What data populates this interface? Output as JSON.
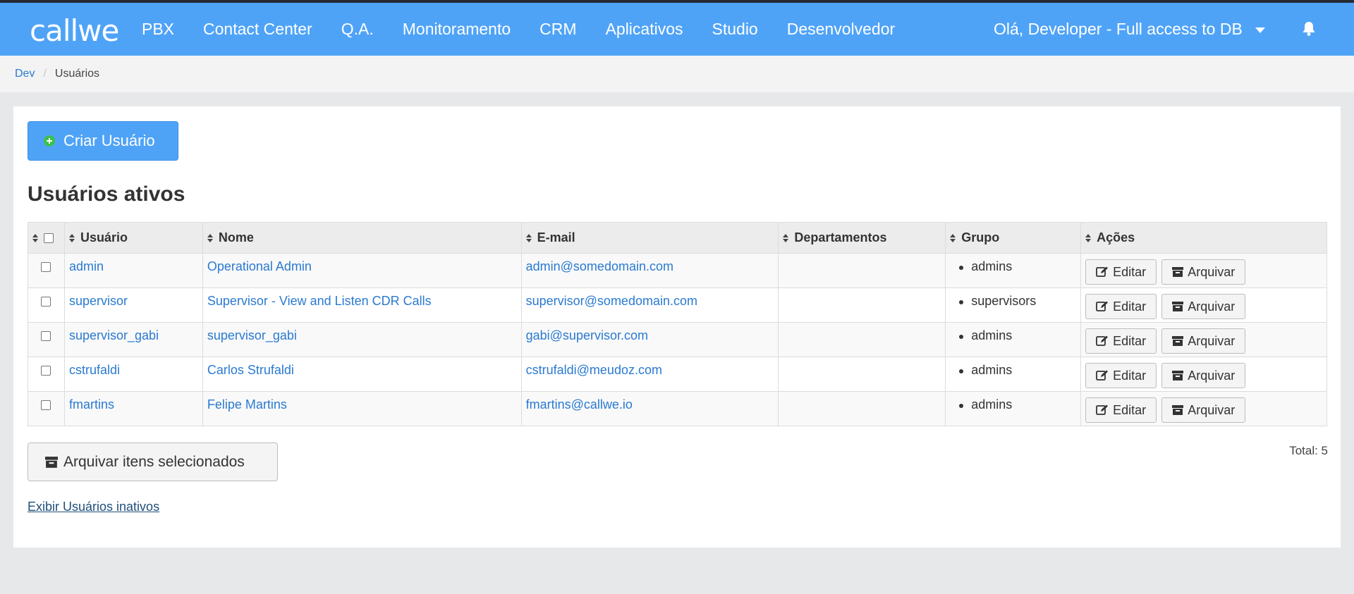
{
  "brand": {
    "logo_text": "callwe"
  },
  "nav": {
    "items": [
      "PBX",
      "Contact Center",
      "Q.A.",
      "Monitoramento",
      "CRM",
      "Aplicativos",
      "Studio",
      "Desenvolvedor"
    ],
    "user_greeting": "Olá, Developer - Full access to DB"
  },
  "breadcrumb": {
    "root": "Dev",
    "separator": "/",
    "current": "Usuários"
  },
  "toolbar": {
    "create_label": "Criar Usuário"
  },
  "section": {
    "title": "Usuários ativos"
  },
  "table": {
    "headers": {
      "usuario": "Usuário",
      "nome": "Nome",
      "email": "E-mail",
      "departamentos": "Departamentos",
      "grupo": "Grupo",
      "acoes": "Ações"
    },
    "rows": [
      {
        "usuario": "admin",
        "nome": "Operational Admin",
        "email": "admin@somedomain.com",
        "departamentos": "",
        "grupo": "admins"
      },
      {
        "usuario": "supervisor",
        "nome": "Supervisor - View and Listen CDR Calls",
        "email": "supervisor@somedomain.com",
        "departamentos": "",
        "grupo": "supervisors"
      },
      {
        "usuario": "supervisor_gabi",
        "nome": "supervisor_gabi",
        "email": "gabi@supervisor.com",
        "departamentos": "",
        "grupo": "admins"
      },
      {
        "usuario": "cstrufaldi",
        "nome": "Carlos Strufaldi",
        "email": "cstrufaldi@meudoz.com",
        "departamentos": "",
        "grupo": "admins"
      },
      {
        "usuario": "fmartins",
        "nome": "Felipe Martins",
        "email": "fmartins@callwe.io",
        "departamentos": "",
        "grupo": "admins"
      }
    ],
    "edit_label": "Editar",
    "archive_label": "Arquivar"
  },
  "footer": {
    "archive_selected_label": "Arquivar itens selecionados",
    "total_label": "Total: 5",
    "show_inactive_label": "Exibir Usuários inativos"
  },
  "colors": {
    "navbar": "#4fa3f7",
    "link": "#2a7ad1",
    "create_button": "#4fa3f7",
    "plus_icon": "#39c24a"
  },
  "icons": {
    "create": "plus-circle-icon",
    "edit": "edit-icon",
    "archive": "archive-icon",
    "notifications": "bell-icon",
    "user_menu": "caret-down-icon"
  }
}
